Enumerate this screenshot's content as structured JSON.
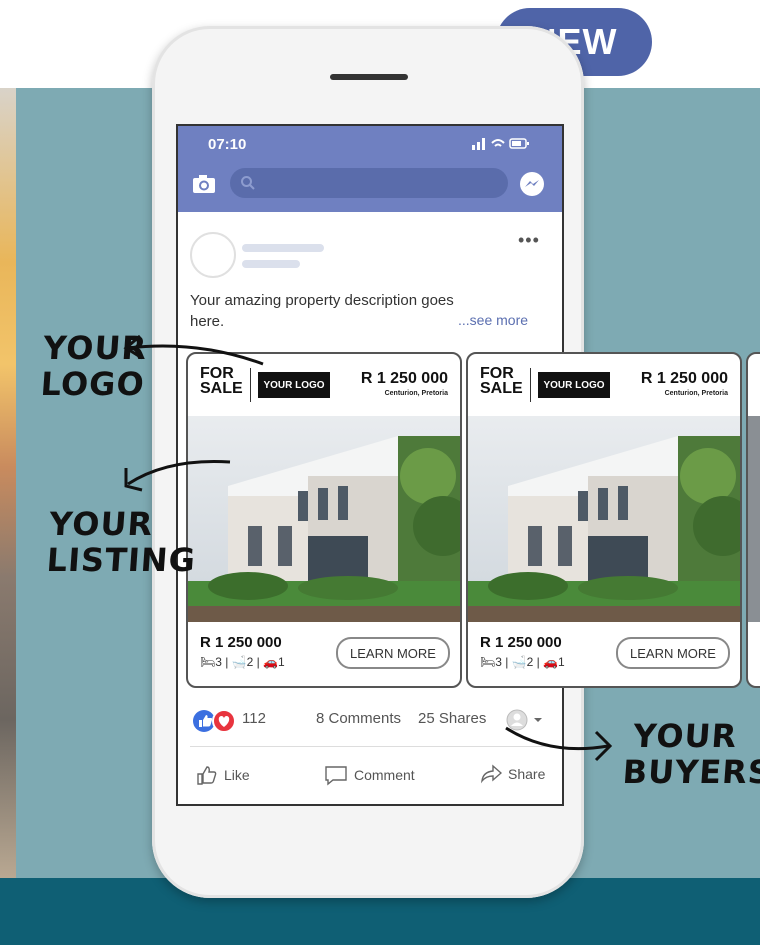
{
  "badge": {
    "label": "NEW",
    "color": "#4f64a8"
  },
  "status_bar": {
    "time": "07:10"
  },
  "post": {
    "description": "Your amazing property description goes here.",
    "see_more": "...see more",
    "more_menu": "•••"
  },
  "cards": [
    {
      "for_sale": "FOR SALE",
      "logo_text": "YOUR LOGO",
      "price": "R 1 250 000",
      "location": "Centurion, Pretoria",
      "bottom_price": "R 1 250 000",
      "features": "🛏3 | 🛁2 | 🚗1",
      "cta": "LEARN MORE"
    },
    {
      "for_sale": "FOR SALE",
      "logo_text": "YOUR LOGO",
      "price": "R 1 250 000",
      "location": "Centurion, Pretoria",
      "bottom_price": "R 1 250 000",
      "features": "🛏3 | 🛁2 | 🚗1",
      "cta": "LEARN MORE"
    }
  ],
  "engagement": {
    "reaction_count": "112",
    "comments": "8 Comments",
    "shares": "25 Shares"
  },
  "actions": {
    "like": "Like",
    "comment": "Comment",
    "share": "Share"
  },
  "annotations": {
    "logo": "YOUR LOGO",
    "listing": "YOUR LISTING",
    "buyers": "YOUR BUYERS"
  },
  "colors": {
    "teal": "#7eaab3",
    "dark_teal": "#0f5f74",
    "facebook_blue": "#6f80c1"
  }
}
